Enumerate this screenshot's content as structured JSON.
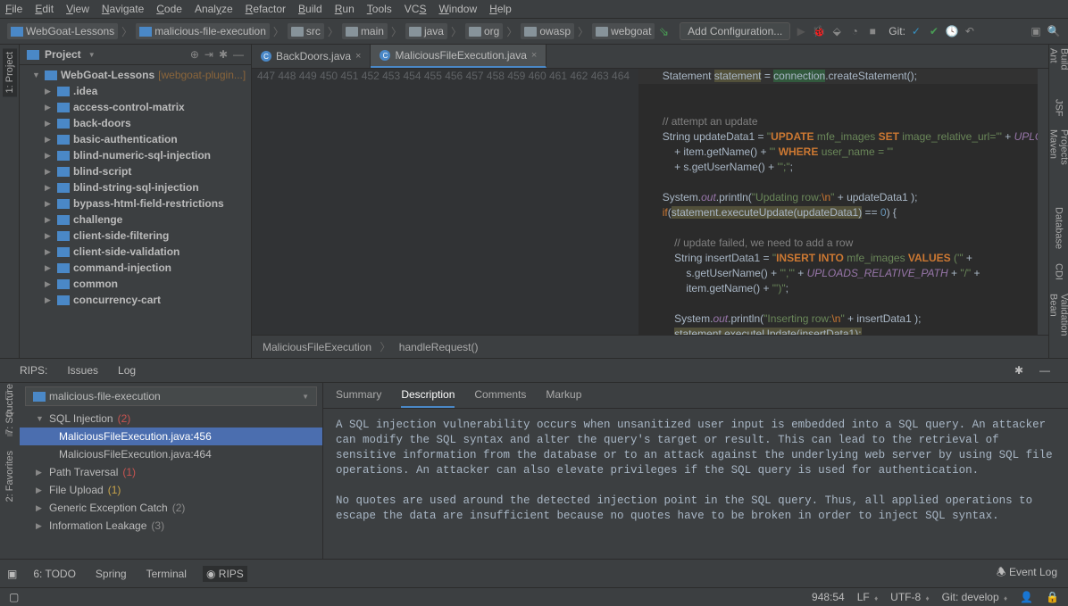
{
  "menu": [
    "File",
    "Edit",
    "View",
    "Navigate",
    "Code",
    "Analyze",
    "Refactor",
    "Build",
    "Run",
    "Tools",
    "VCS",
    "Window",
    "Help"
  ],
  "menu_underline": [
    0,
    0,
    0,
    0,
    0,
    4,
    0,
    0,
    0,
    0,
    2,
    0,
    0
  ],
  "breadcrumbs": [
    "WebGoat-Lessons",
    "malicious-file-execution",
    "src",
    "main",
    "java",
    "org",
    "owasp",
    "webgoat"
  ],
  "add_config": "Add Configuration...",
  "vcs_label": "Git:",
  "project_panel": {
    "title": "Project"
  },
  "tree": {
    "root": "WebGoat-Lessons",
    "module": "[webgoat-plugin...]",
    "items": [
      ".idea",
      "access-control-matrix",
      "back-doors",
      "basic-authentication",
      "blind-numeric-sql-injection",
      "blind-script",
      "blind-string-sql-injection",
      "bypass-html-field-restrictions",
      "challenge",
      "client-side-filtering",
      "client-side-validation",
      "command-injection",
      "common",
      "concurrency-cart"
    ]
  },
  "left_tabs": [
    "1: Project"
  ],
  "left_tabs2": [
    "7: Structure",
    "2: Favorites"
  ],
  "right_tabs": [
    "Ant Build",
    "JSF",
    "Maven Projects",
    "Database",
    "CDI",
    "Bean Validation"
  ],
  "editor_tabs": [
    {
      "name": "BackDoors.java",
      "active": false
    },
    {
      "name": "MaliciousFileExecution.java",
      "active": true
    }
  ],
  "line_start": 447,
  "line_count": 18,
  "crumb": {
    "class": "MaliciousFileExecution",
    "method": "handleRequest()"
  },
  "rips": {
    "header_tabs": [
      "RIPS:",
      "Issues",
      "Log"
    ],
    "dropdown": "malicious-file-execution",
    "issues": [
      {
        "name": "SQL Injection",
        "count": "(2)",
        "count_class": "count-red",
        "depth": 1,
        "open": true
      },
      {
        "name": "MaliciousFileExecution.java:456",
        "depth": 2,
        "sel": true
      },
      {
        "name": "MaliciousFileExecution.java:464",
        "depth": 2
      },
      {
        "name": "Path Traversal",
        "count": "(1)",
        "count_class": "count-red",
        "depth": 1
      },
      {
        "name": "File Upload",
        "count": "(1)",
        "count_class": "count-orange",
        "depth": 1
      },
      {
        "name": "Generic Exception Catch",
        "count": "(2)",
        "count_class": "count-gray",
        "depth": 1
      },
      {
        "name": "Information Leakage",
        "count": "(3)",
        "count_class": "count-gray",
        "depth": 1
      }
    ],
    "detail_tabs": [
      "Summary",
      "Description",
      "Comments",
      "Markup"
    ],
    "detail_active": 1,
    "description": "A SQL injection vulnerability occurs when unsanitized user input is embedded into a SQL query. An attacker can modify the SQL syntax and alter the query's target or result. This can lead to the retrieval of sensitive information from the database or to an attack against the underlying web server by using SQL file operations. An attacker can also elevate privileges if the SQL query is used for authentication.\n\nNo quotes are used around the detected injection point in the SQL query. Thus, all applied operations to escape the data are insufficient because no quotes have to be broken in order to inject SQL syntax."
  },
  "bottom_tool": [
    "6: TODO",
    "Spring",
    "Terminal",
    "RIPS"
  ],
  "bottom_active": 3,
  "event_log": "Event Log",
  "status": {
    "pos": "948:54",
    "sep": "LF",
    "enc": "UTF-8",
    "git": "Git: develop"
  }
}
